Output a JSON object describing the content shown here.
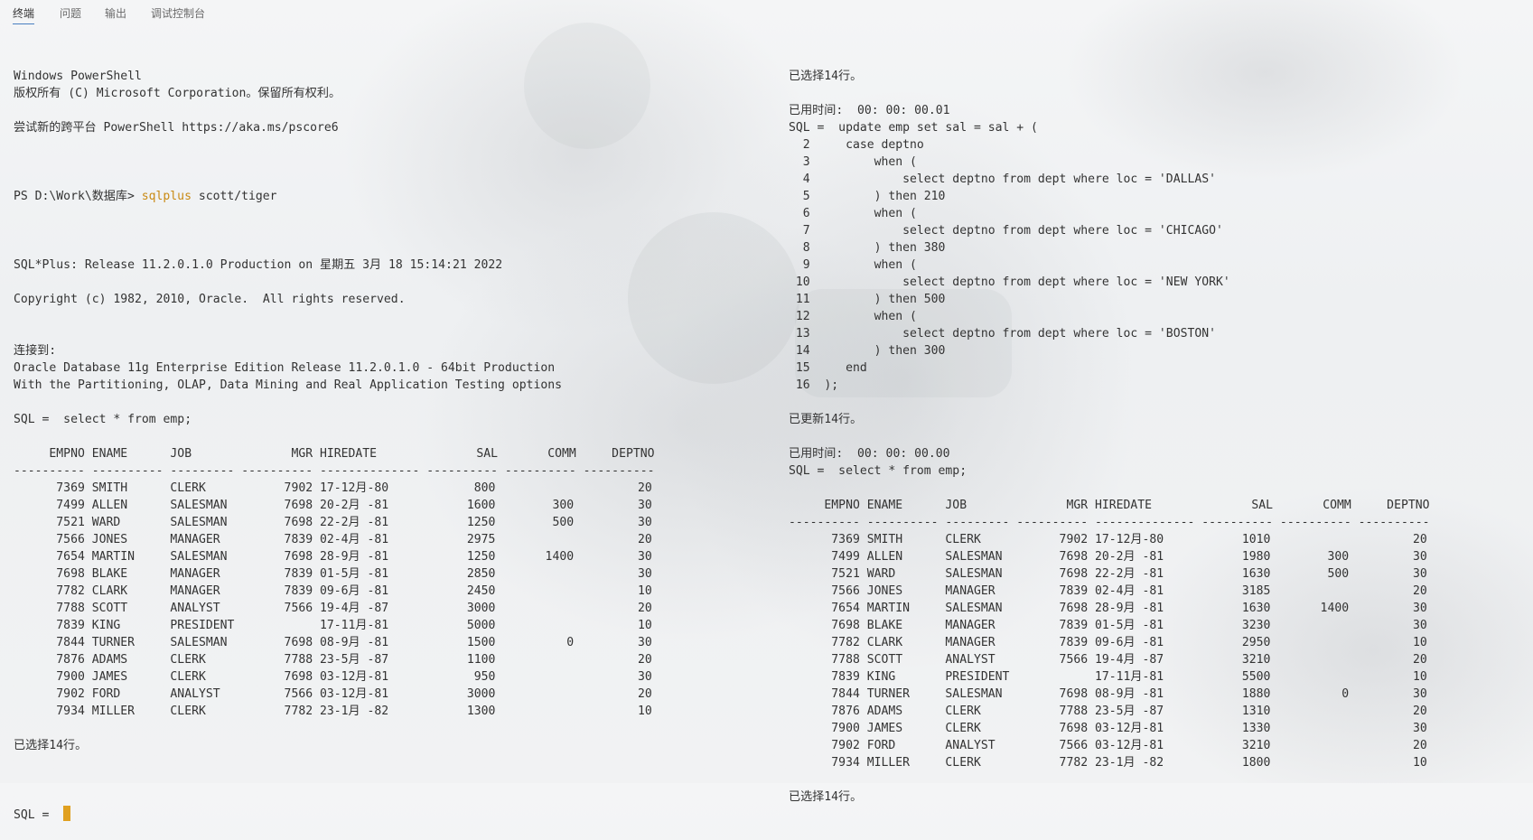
{
  "tabs": [
    {
      "label": "终端",
      "active": true
    },
    {
      "label": "问题",
      "active": false
    },
    {
      "label": "输出",
      "active": false
    },
    {
      "label": "调试控制台",
      "active": false
    }
  ],
  "left_terminal": {
    "header_lines": [
      "Windows PowerShell",
      "版权所有 (C) Microsoft Corporation。保留所有权利。",
      "",
      "尝试新的跨平台 PowerShell https://aka.ms/pscore6",
      ""
    ],
    "prompt_prefix": "PS D:\\Work\\数据库> ",
    "prompt_command": "sqlplus",
    "prompt_args": " scott/tiger",
    "after_prompt_lines": [
      "",
      "SQL*Plus: Release 11.2.0.1.0 Production on 星期五 3月 18 15:14:21 2022",
      "",
      "Copyright (c) 1982, 2010, Oracle.  All rights reserved.",
      "",
      "",
      "连接到:",
      "Oracle Database 11g Enterprise Edition Release 11.2.0.1.0 - 64bit Production",
      "With the Partitioning, OLAP, Data Mining and Real Application Testing options",
      "",
      "SQL =  select * from emp;",
      "",
      "     EMPNO ENAME      JOB              MGR HIREDATE              SAL       COMM     DEPTNO",
      "---------- ---------- --------- ---------- -------------- ---------- ---------- ----------",
      "      7369 SMITH      CLERK           7902 17-12月-80            800                    20",
      "      7499 ALLEN      SALESMAN        7698 20-2月 -81           1600        300         30",
      "      7521 WARD       SALESMAN        7698 22-2月 -81           1250        500         30",
      "      7566 JONES      MANAGER         7839 02-4月 -81           2975                    20",
      "      7654 MARTIN     SALESMAN        7698 28-9月 -81           1250       1400         30",
      "      7698 BLAKE      MANAGER         7839 01-5月 -81           2850                    30",
      "      7782 CLARK      MANAGER         7839 09-6月 -81           2450                    10",
      "      7788 SCOTT      ANALYST         7566 19-4月 -87           3000                    20",
      "      7839 KING       PRESIDENT            17-11月-81           5000                    10",
      "      7844 TURNER     SALESMAN        7698 08-9月 -81           1500          0         30",
      "      7876 ADAMS      CLERK           7788 23-5月 -87           1100                    20",
      "      7900 JAMES      CLERK           7698 03-12月-81            950                    30",
      "      7902 FORD       ANALYST         7566 03-12月-81           3000                    20",
      "      7934 MILLER     CLERK           7782 23-1月 -82           1300                    10",
      "",
      "已选择14行。",
      ""
    ],
    "input_prompt": "SQL =  "
  },
  "right_terminal": {
    "lines": [
      "已选择14行。",
      "",
      "已用时间:  00: 00: 00.01",
      "SQL =  update emp set sal = sal + (",
      "  2     case deptno",
      "  3         when (",
      "  4             select deptno from dept where loc = 'DALLAS'",
      "  5         ) then 210",
      "  6         when (",
      "  7             select deptno from dept where loc = 'CHICAGO'",
      "  8         ) then 380",
      "  9         when (",
      " 10             select deptno from dept where loc = 'NEW YORK'",
      " 11         ) then 500",
      " 12         when (",
      " 13             select deptno from dept where loc = 'BOSTON'",
      " 14         ) then 300",
      " 15     end",
      " 16  );",
      "",
      "已更新14行。",
      "",
      "已用时间:  00: 00: 00.00",
      "SQL =  select * from emp;",
      "",
      "     EMPNO ENAME      JOB              MGR HIREDATE              SAL       COMM     DEPTNO",
      "---------- ---------- --------- ---------- -------------- ---------- ---------- ----------",
      "      7369 SMITH      CLERK           7902 17-12月-80           1010                    20",
      "      7499 ALLEN      SALESMAN        7698 20-2月 -81           1980        300         30",
      "      7521 WARD       SALESMAN        7698 22-2月 -81           1630        500         30",
      "      7566 JONES      MANAGER         7839 02-4月 -81           3185                    20",
      "      7654 MARTIN     SALESMAN        7698 28-9月 -81           1630       1400         30",
      "      7698 BLAKE      MANAGER         7839 01-5月 -81           3230                    30",
      "      7782 CLARK      MANAGER         7839 09-6月 -81           2950                    10",
      "      7788 SCOTT      ANALYST         7566 19-4月 -87           3210                    20",
      "      7839 KING       PRESIDENT            17-11月-81           5500                    10",
      "      7844 TURNER     SALESMAN        7698 08-9月 -81           1880          0         30",
      "      7876 ADAMS      CLERK           7788 23-5月 -87           1310                    20",
      "      7900 JAMES      CLERK           7698 03-12月-81           1330                    30",
      "      7902 FORD       ANALYST         7566 03-12月-81           3210                    20",
      "      7934 MILLER     CLERK           7782 23-1月 -82           1800                    10",
      "",
      "已选择14行。"
    ]
  }
}
